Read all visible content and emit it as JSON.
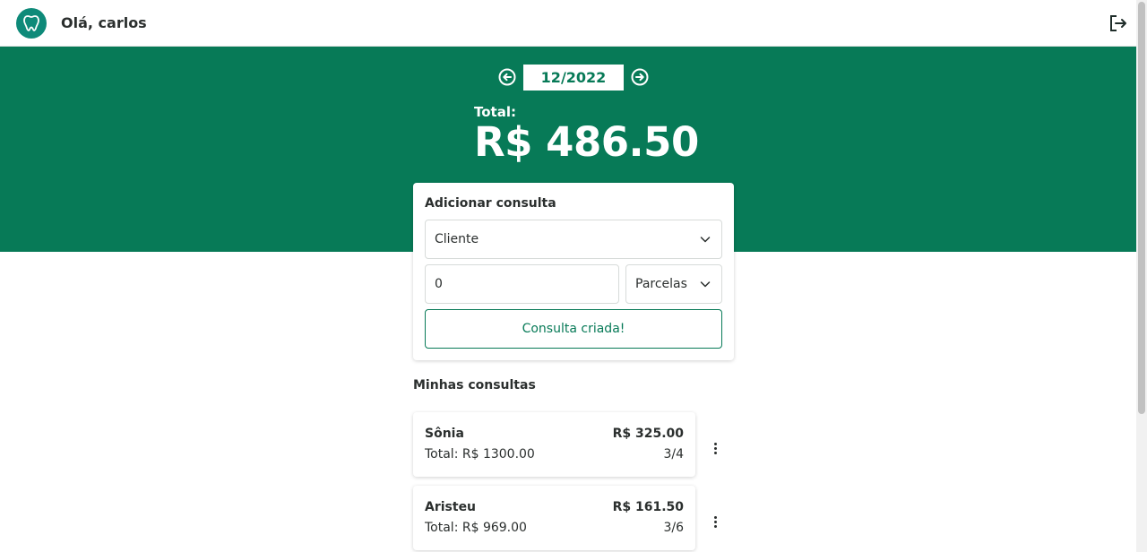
{
  "header": {
    "greeting": "Olá, carlos",
    "logo_icon": "tooth-icon",
    "logout_icon": "logout-icon"
  },
  "period": {
    "month": "12/2022",
    "prev_icon": "arrow-left-circle-icon",
    "next_icon": "arrow-right-circle-icon"
  },
  "summary": {
    "total_label": "Total:",
    "total_value": "R$ 486.50"
  },
  "form": {
    "title": "Adicionar consulta",
    "client_select": "Cliente",
    "value_input": "0",
    "installments_select": "Parcelas",
    "submit_label": "Consulta criada!"
  },
  "list": {
    "title": "Minhas consultas",
    "items": [
      {
        "name": "Sônia",
        "amount": "R$ 325.00",
        "total": "Total: R$ 1300.00",
        "installment": "3/4"
      },
      {
        "name": "Aristeu",
        "amount": "R$ 161.50",
        "total": "Total: R$ 969.00",
        "installment": "3/6"
      }
    ]
  },
  "colors": {
    "primary": "#077a57",
    "logo": "#0e8a79",
    "text": "#2b2f2e"
  }
}
